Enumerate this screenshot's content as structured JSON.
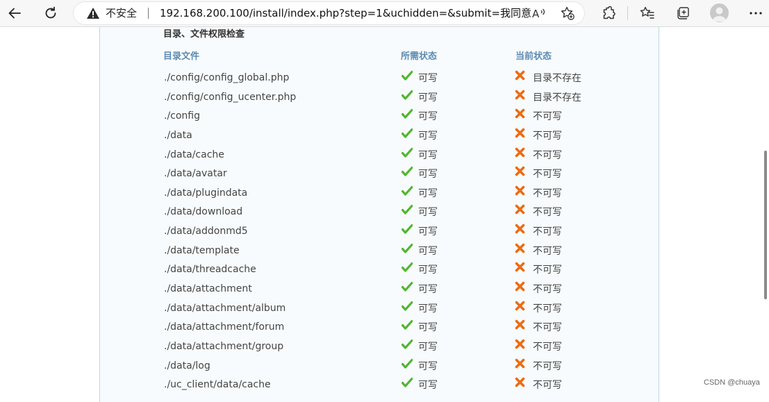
{
  "browser": {
    "security_label": "不安全",
    "url": "192.168.200.100/install/index.php?step=1&uchidden=&submit=我同意",
    "icons": [
      "back-icon",
      "refresh-icon",
      "warning-icon",
      "read-aloud-icon",
      "add-favorite-icon",
      "extensions-icon",
      "favorites-icon",
      "collections-icon",
      "profile-avatar",
      "more-icon"
    ]
  },
  "page": {
    "section_title": "目录、文件权限检查",
    "headers": {
      "path": "目录文件",
      "required": "所需状态",
      "current": "当前状态"
    },
    "rows": [
      {
        "path": "./config/config_global.php",
        "required": "可写",
        "current": "目录不存在"
      },
      {
        "path": "./config/config_ucenter.php",
        "required": "可写",
        "current": "目录不存在"
      },
      {
        "path": "./config",
        "required": "可写",
        "current": "不可写"
      },
      {
        "path": "./data",
        "required": "可写",
        "current": "不可写"
      },
      {
        "path": "./data/cache",
        "required": "可写",
        "current": "不可写"
      },
      {
        "path": "./data/avatar",
        "required": "可写",
        "current": "不可写"
      },
      {
        "path": "./data/plugindata",
        "required": "可写",
        "current": "不可写"
      },
      {
        "path": "./data/download",
        "required": "可写",
        "current": "不可写"
      },
      {
        "path": "./data/addonmd5",
        "required": "可写",
        "current": "不可写"
      },
      {
        "path": "./data/template",
        "required": "可写",
        "current": "不可写"
      },
      {
        "path": "./data/threadcache",
        "required": "可写",
        "current": "不可写"
      },
      {
        "path": "./data/attachment",
        "required": "可写",
        "current": "不可写"
      },
      {
        "path": "./data/attachment/album",
        "required": "可写",
        "current": "不可写"
      },
      {
        "path": "./data/attachment/forum",
        "required": "可写",
        "current": "不可写"
      },
      {
        "path": "./data/attachment/group",
        "required": "可写",
        "current": "不可写"
      },
      {
        "path": "./data/log",
        "required": "可写",
        "current": "不可写"
      },
      {
        "path": "./uc_client/data/cache",
        "required": "可写",
        "current": "不可写"
      }
    ],
    "colors": {
      "ok": "#52b631",
      "bad": "#ee6b13",
      "header": "#5c8bb3"
    }
  },
  "watermark": "CSDN @chuaya"
}
